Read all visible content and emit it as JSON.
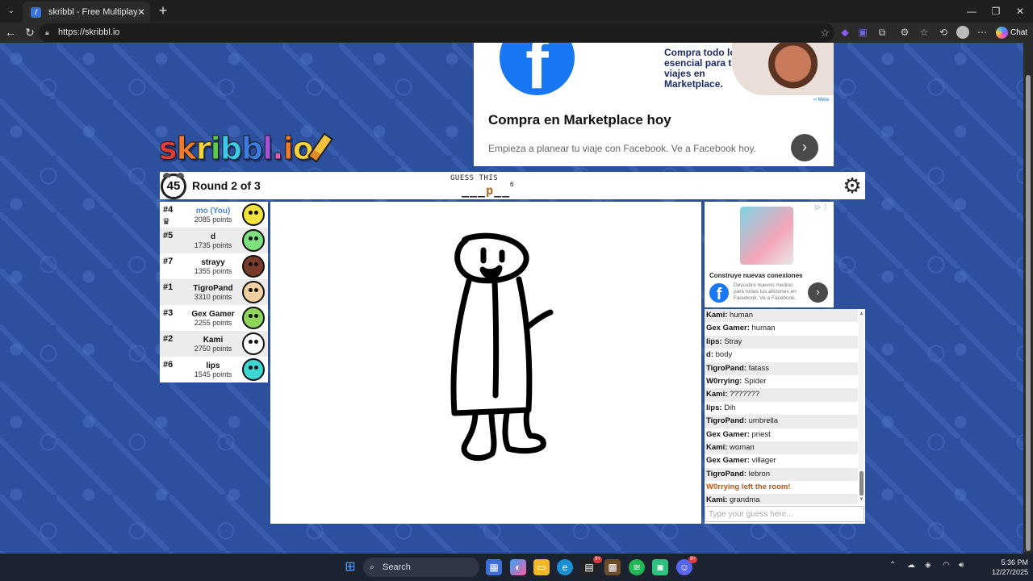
{
  "browser": {
    "tab_title": "skribbl - Free Multiplayer Dra",
    "url": "https://skribbl.io",
    "chat_label": "Chat"
  },
  "top_ad": {
    "blurb": "Compra todo lo esencial para tus viajes en Marketplace.",
    "meta_label": "∞ Meta",
    "headline": "Compra en Marketplace hoy",
    "subtext": "Empieza a planear tu viaje con Facebook. Ve a Facebook hoy."
  },
  "logo": {
    "letters": [
      "s",
      "k",
      "r",
      "i",
      "b",
      "b",
      "l",
      ".",
      "i",
      "o"
    ],
    "colors": [
      "#e63b3b",
      "#f07b2b",
      "#f5d33c",
      "#5ccd48",
      "#3ec8e8",
      "#3a7be0",
      "#a653e0",
      "#e85ab6",
      "#f07b2b",
      "#f5d33c"
    ]
  },
  "game": {
    "timer": "45",
    "round": "Round 2 of 3",
    "guess_label": "GUESS THIS",
    "hint_pre": "___",
    "hint_revealed": "p",
    "hint_post": "__",
    "word_length": "6"
  },
  "players": [
    {
      "rank": "#4",
      "name": "mo (You)",
      "points": "2085 points",
      "you": true,
      "color": "#f4e23c",
      "crown": true
    },
    {
      "rank": "#5",
      "name": "d",
      "points": "1735 points",
      "color": "#7fe07f"
    },
    {
      "rank": "#7",
      "name": "strayy",
      "points": "1355 points",
      "color": "#7a3b2a"
    },
    {
      "rank": "#1",
      "name": "TigroPand",
      "points": "3310 points",
      "color": "#f3cfa0"
    },
    {
      "rank": "#3",
      "name": "Gex Gamer",
      "points": "2255 points",
      "color": "#8ed65a"
    },
    {
      "rank": "#2",
      "name": "Kami",
      "points": "2750 points",
      "color": "#ffffff"
    },
    {
      "rank": "#6",
      "name": "lips",
      "points": "1545 points",
      "color": "#3fd6d6"
    }
  ],
  "side_ad": {
    "title": "Construye nuevas conexiones",
    "text": "Descubre nuevos medios para todas tus aficiones en Facebook. Ve a Facebook."
  },
  "chat": {
    "messages": [
      {
        "user": "Kami",
        "text": "human"
      },
      {
        "user": "Gex Gamer",
        "text": "human"
      },
      {
        "user": "lips",
        "text": "Stray"
      },
      {
        "user": "d",
        "text": "body"
      },
      {
        "user": "TigroPand",
        "text": "fatass"
      },
      {
        "user": "W0rrying",
        "text": "Spider"
      },
      {
        "user": "Kami",
        "text": "???????"
      },
      {
        "user": "lips",
        "text": "Dih"
      },
      {
        "user": "TigroPand",
        "text": "umbrella"
      },
      {
        "user": "Gex Gamer",
        "text": "priest"
      },
      {
        "user": "Kami",
        "text": "woman"
      },
      {
        "user": "Gex Gamer",
        "text": "villager"
      },
      {
        "user": "TigroPand",
        "text": "lebron"
      },
      {
        "system": "W0rrying left the room!"
      },
      {
        "user": "Kami",
        "text": "grandma"
      }
    ],
    "input_placeholder": "Type your guess here..."
  },
  "taskbar": {
    "search_label": "Search",
    "time": "5:36 PM",
    "date": "12/27/2025"
  }
}
